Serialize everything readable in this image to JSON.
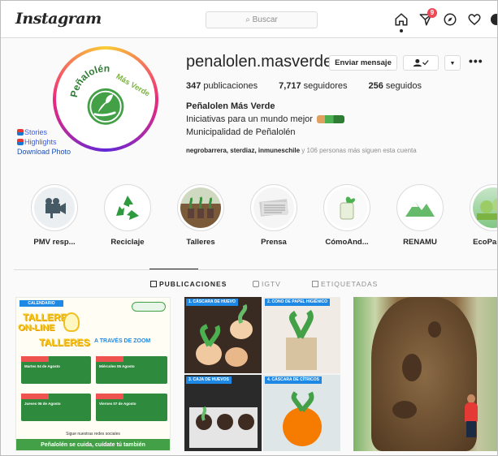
{
  "topbar": {
    "logo": "Instagram",
    "search_placeholder": "Buscar",
    "notif_count": "9"
  },
  "profile": {
    "username": "penalolen.masverde",
    "send_message_label": "Enviar mensaje",
    "more_label": "•••",
    "stats": {
      "posts_count": "347",
      "posts_label": "publicaciones",
      "followers_count": "7,717",
      "followers_label": "seguidores",
      "following_count": "256",
      "following_label": "seguidos"
    },
    "bio_name": "Peñalolen Más Verde",
    "bio_line1": "Iniciativas para un mundo mejor",
    "bio_line2": "Municipalidad de Peñalolén",
    "followed_by_names": "negrobarrera, sterdiaz, inmuneschile",
    "followed_by_rest": " y 106 personas más siguen esta cuenta",
    "logo_text_top": "Peñalolén",
    "logo_text_green": "Más Verde"
  },
  "side_links": {
    "stories": "Stories",
    "highlights": "Highlights",
    "download": "Download Photo"
  },
  "highlights": [
    {
      "label": "PMV resp..."
    },
    {
      "label": "Reciclaje"
    },
    {
      "label": "Talleres"
    },
    {
      "label": "Prensa"
    },
    {
      "label": "CómoAnd..."
    },
    {
      "label": "RENAMU"
    },
    {
      "label": "EcoParque"
    }
  ],
  "tabs": {
    "posts": "PUBLICACIONES",
    "igtv": "IGTV",
    "tagged": "ETIQUETADAS"
  },
  "posts": {
    "p1": {
      "calendar": "CALENDARIO SEMANAL",
      "title1": "TALLERES",
      "title2": "ON-LINE",
      "title3": "TALLERES",
      "via": "A TRAVÉS DE ZOOM",
      "box1": "Martes 04 de Agosto",
      "box2": "Miércoles 05 Agosto",
      "box3": "Jueves 06 de Agosto",
      "box4": "Viernes 07 de Agosto",
      "bottom": "Peñalolén se cuida, cuídate tú también",
      "social": "Sigue nuestras redes sociales"
    },
    "p2": {
      "q1": "1. CÁSCARA DE HUEVO",
      "q2": "2. CONO DE PAPEL HIGIÉNICO",
      "q3": "3. CAJA DE HUEVOS",
      "q4": "4. CÁSCARA DE CÍTRICOS"
    }
  },
  "colors": {
    "accent_green": "#43a047",
    "link_blue": "#3b5bdb",
    "notification_red": "#ed4956"
  }
}
